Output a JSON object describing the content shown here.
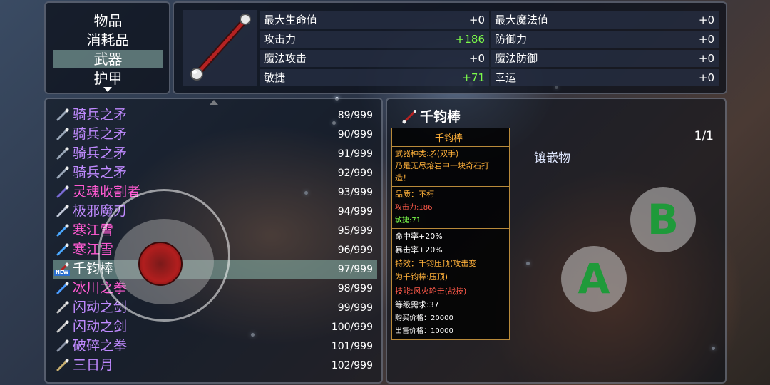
{
  "categories": [
    {
      "label": "物品",
      "selected": false
    },
    {
      "label": "消耗品",
      "selected": false
    },
    {
      "label": "武器",
      "selected": true
    },
    {
      "label": "护甲",
      "selected": false
    }
  ],
  "stats": {
    "max_hp": {
      "label": "最大生命值",
      "value": "+0"
    },
    "max_mp": {
      "label": "最大魔法值",
      "value": "+0"
    },
    "atk": {
      "label": "攻击力",
      "value": "+186"
    },
    "def": {
      "label": "防御力",
      "value": "+0"
    },
    "matk": {
      "label": "魔法攻击",
      "value": "+0"
    },
    "mdef": {
      "label": "魔法防御",
      "value": "+0"
    },
    "agi": {
      "label": "敏捷",
      "value": "+71"
    },
    "luck": {
      "label": "幸运",
      "value": "+0"
    }
  },
  "items": [
    {
      "name": "骑兵之矛",
      "count": "89/999",
      "color": "#c08aff",
      "icon": "spear-icon"
    },
    {
      "name": "骑兵之矛",
      "count": "90/999",
      "color": "#c08aff",
      "icon": "spear-icon"
    },
    {
      "name": "骑兵之矛",
      "count": "91/999",
      "color": "#c08aff",
      "icon": "spear-icon"
    },
    {
      "name": "骑兵之矛",
      "count": "92/999",
      "color": "#c08aff",
      "icon": "spear-icon"
    },
    {
      "name": "灵魂收割者",
      "count": "93/999",
      "color": "#ff5ad2",
      "icon": "scythe-icon"
    },
    {
      "name": "极邪魔刃",
      "count": "94/999",
      "color": "#c08aff",
      "icon": "blade-icon"
    },
    {
      "name": "寒江雪",
      "count": "95/999",
      "color": "#ff5ad2",
      "icon": "ice-spear-icon"
    },
    {
      "name": "寒江雪",
      "count": "96/999",
      "color": "#ff5ad2",
      "icon": "ice-spear-icon"
    },
    {
      "name": "千钧棒",
      "count": "97/999",
      "color": "#ffffff",
      "icon": "staff-icon",
      "selected": true,
      "new": "NEW"
    },
    {
      "name": "冰川之拳",
      "count": "98/999",
      "color": "#ff5ad2",
      "icon": "ice-fist-icon"
    },
    {
      "name": "闪动之剑",
      "count": "99/999",
      "color": "#c08aff",
      "icon": "sword-icon"
    },
    {
      "name": "闪动之剑",
      "count": "100/999",
      "color": "#c08aff",
      "icon": "sword-icon"
    },
    {
      "name": "破碎之拳",
      "count": "101/999",
      "color": "#c08aff",
      "icon": "fist-icon"
    },
    {
      "name": "三日月",
      "count": "102/999",
      "color": "#c08aff",
      "icon": "katana-icon"
    }
  ],
  "detail": {
    "title": "千钧棒",
    "page": "1/1",
    "socket_label": "镶嵌物",
    "tooltip": {
      "name": "千钧棒",
      "type": "武器种类:矛(双手)",
      "desc1": "乃是无尽熔岩中一块奇石打",
      "desc2": "造！",
      "quality": "品质：不朽",
      "atk": "攻击力:186",
      "agi": "敏捷:71",
      "hit": "命中率+20%",
      "crit": "暴击率+20%",
      "effect1": "特效：千钧压顶(攻击变",
      "effect2": "为千钧棒:压顶)",
      "skill": "技能:风火轮击(战技)",
      "level": "等级需求:37",
      "buy": "购买价格：20000",
      "sell": "出售价格：10000"
    }
  },
  "controls": {
    "b": "B",
    "a": "A"
  }
}
